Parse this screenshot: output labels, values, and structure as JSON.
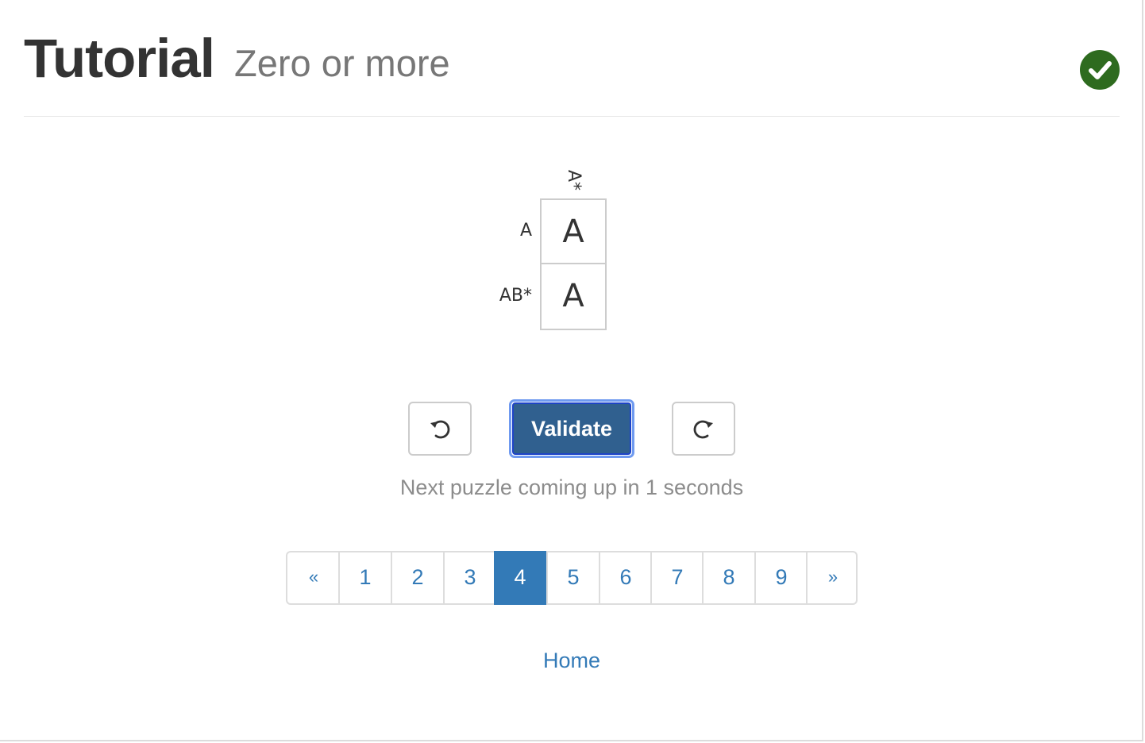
{
  "header": {
    "title": "Tutorial",
    "subtitle": "Zero or more",
    "status_icon": "check-circle-icon",
    "status_color": "#2e6b1f"
  },
  "puzzle": {
    "column_clues": [
      "A*"
    ],
    "row_clues": [
      "A",
      "AB*"
    ],
    "cells": [
      [
        "A"
      ],
      [
        "A"
      ]
    ]
  },
  "controls": {
    "undo_icon": "undo-icon",
    "validate_label": "Validate",
    "redo_icon": "redo-icon",
    "status_text": "Next puzzle coming up in 1 seconds"
  },
  "pagination": {
    "prev_label": "«",
    "pages": [
      "1",
      "2",
      "3",
      "4",
      "5",
      "6",
      "7",
      "8",
      "9"
    ],
    "active_page": "4",
    "next_label": "»",
    "accent": "#337ab7"
  },
  "footer": {
    "home_label": "Home"
  }
}
